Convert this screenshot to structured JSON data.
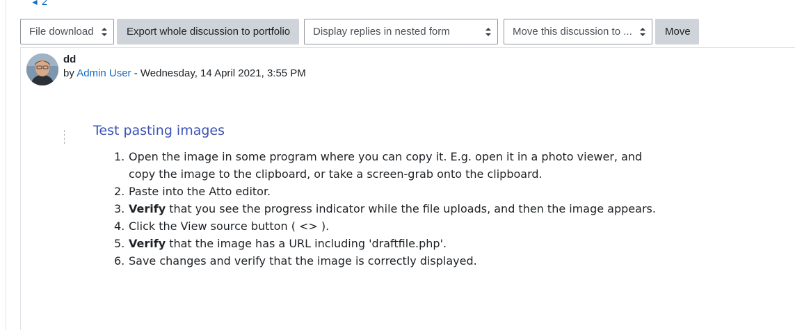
{
  "nav": {
    "prev_page_label": "2",
    "prev_icon": "triangle-left-icon"
  },
  "toolbar": {
    "file_download": "File download",
    "export_button": "Export whole discussion to portfolio",
    "display_mode": "Display replies in nested form",
    "move_to": "Move this discussion to ...",
    "move_button": "Move"
  },
  "post": {
    "subject": "dd",
    "by_prefix": "by",
    "author": "Admin User",
    "date_text": " - Wednesday, 14 April 2021, 3:55 PM",
    "content_title": "Test pasting images",
    "steps": [
      {
        "num": "1.",
        "bold": "",
        "text": "Open the image in some program where you can copy it. E.g. open it in a photo viewer, and copy the image to the clipboard, or take a screen-grab onto the clipboard."
      },
      {
        "num": "2.",
        "bold": "",
        "text": "Paste into the Atto editor."
      },
      {
        "num": "3.",
        "bold": "Verify",
        "text": " that you see the progress indicator while the file uploads, and then the image appears."
      },
      {
        "num": "4.",
        "bold": "",
        "text": "Click the View source button ( <> )."
      },
      {
        "num": "5.",
        "bold": "Verify",
        "text": " that the image has a URL including 'draftfile.php'."
      },
      {
        "num": "6.",
        "bold": "",
        "text": "Save changes and verify that the image is correctly displayed."
      }
    ]
  },
  "colors": {
    "link": "#0f6cbf",
    "heading": "#3a52b4",
    "button_bg": "#ced4da"
  }
}
